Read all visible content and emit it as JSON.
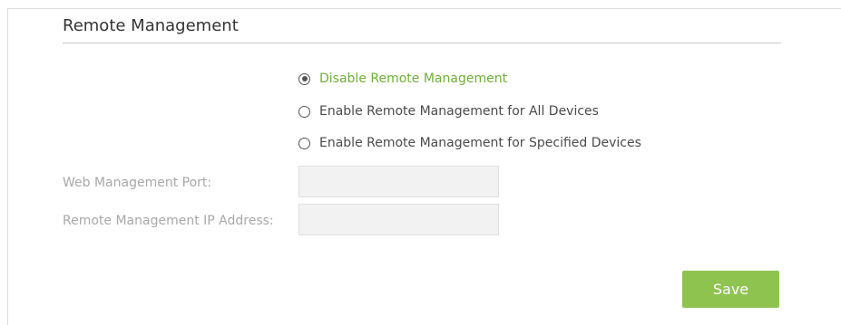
{
  "section": {
    "title": "Remote Management"
  },
  "remote_mode": {
    "selected": "disable",
    "options": [
      {
        "id": "disable",
        "label": "Disable Remote Management",
        "checked": true
      },
      {
        "id": "all",
        "label": "Enable Remote Management for All Devices",
        "checked": false
      },
      {
        "id": "specified",
        "label": "Enable Remote Management for Specified Devices",
        "checked": false
      }
    ]
  },
  "fields": {
    "web_port": {
      "label": "Web Management Port:",
      "value": "",
      "disabled": true
    },
    "ip_address": {
      "label": "Remote Management IP Address:",
      "value": "",
      "disabled": true
    }
  },
  "actions": {
    "save_label": "Save"
  },
  "colors": {
    "accent_green": "#8fc350",
    "selected_text": "#6fae3a",
    "label_disabled": "#a8a8a8",
    "input_bg": "#f2f2f2"
  }
}
